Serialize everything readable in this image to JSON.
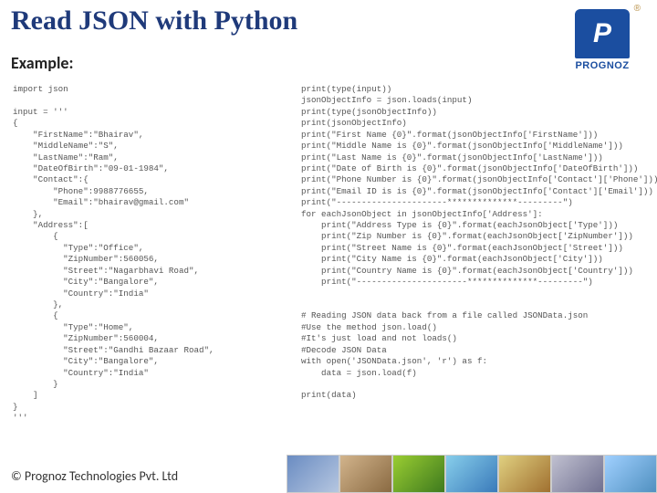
{
  "title": "Read JSON with Python",
  "subtitle": "Example",
  "logo": {
    "brand": "PROGNOZ",
    "reg": "®"
  },
  "code_left": "import json\n\ninput = '''\n{\n    \"FirstName\":\"Bhairav\",\n    \"MiddleName\":\"S\",\n    \"LastName\":\"Ram\",\n    \"DateOfBirth\":\"09-01-1984\",\n    \"Contact\":{\n        \"Phone\":9988776655,\n        \"Email\":\"bhairav@gmail.com\"\n    },\n    \"Address\":[\n        {\n          \"Type\":\"Office\",\n          \"ZipNumber\":560056,\n          \"Street\":\"Nagarbhavi Road\",\n          \"City\":\"Bangalore\",\n          \"Country\":\"India\"\n        },\n        {\n          \"Type\":\"Home\",\n          \"ZipNumber\":560004,\n          \"Street\":\"Gandhi Bazaar Road\",\n          \"City\":\"Bangalore\",\n          \"Country\":\"India\"\n        }\n    ]\n}\n'''",
  "code_right": "print(type(input))\njsonObjectInfo = json.loads(input)\nprint(type(jsonObjectInfo))\nprint(jsonObjectInfo)\nprint(\"First Name {0}\".format(jsonObjectInfo['FirstName']))\nprint(\"Middle Name is {0}\".format(jsonObjectInfo['MiddleName']))\nprint(\"Last Name is {0}\".format(jsonObjectInfo['LastName']))\nprint(\"Date of Birth is {0}\".format(jsonObjectInfo['DateOfBirth']))\nprint(\"Phone Number is {0}\".format(jsonObjectInfo['Contact']['Phone']))\nprint(\"Email ID is is {0}\".format(jsonObjectInfo['Contact']['Email']))\nprint(\"----------------------**************---------\")\nfor eachJsonObject in jsonObjectInfo['Address']:\n    print(\"Address Type is {0}\".format(eachJsonObject['Type']))\n    print(\"Zip Number is {0}\".format(eachJsonObject['ZipNumber']))\n    print(\"Street Name is {0}\".format(eachJsonObject['Street']))\n    print(\"City Name is {0}\".format(eachJsonObject['City']))\n    print(\"Country Name is {0}\".format(eachJsonObject['Country']))\n    print(\"----------------------**************---------\")\n\n\n# Reading JSON data back from a file called JSONData.json\n#Use the method json.load()\n#It's just load and not loads()\n#Decode JSON Data\nwith open('JSONData.json', 'r') as f:\n    data = json.load(f)\n\nprint(data)",
  "footer": "© Prognoz Technologies Pvt. Ltd"
}
